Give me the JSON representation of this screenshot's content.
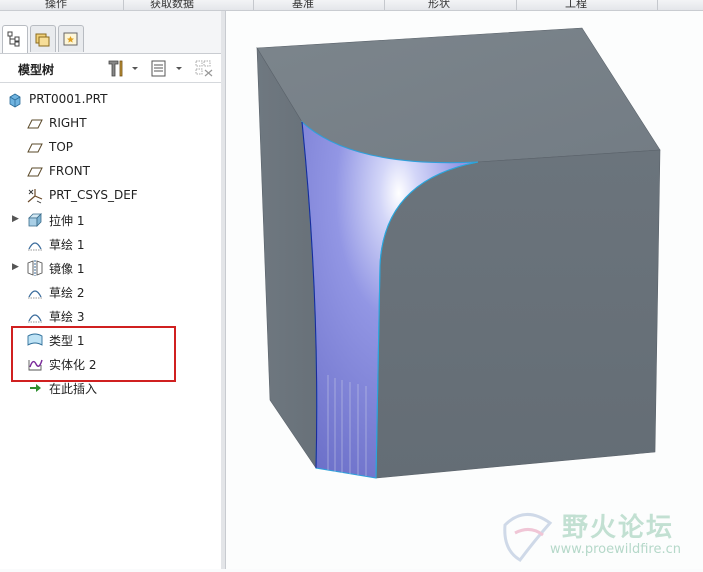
{
  "menu": {
    "items": [
      "操作",
      "获取数据",
      "基准",
      "形状",
      "工程"
    ]
  },
  "panel": {
    "tree_title": "模型树"
  },
  "tree": {
    "items": [
      {
        "label": "PRT0001.PRT",
        "icon": "part-icon",
        "expandable": false
      },
      {
        "label": "RIGHT",
        "icon": "datum-plane-icon",
        "expandable": false
      },
      {
        "label": "TOP",
        "icon": "datum-plane-icon",
        "expandable": false
      },
      {
        "label": "FRONT",
        "icon": "datum-plane-icon",
        "expandable": false
      },
      {
        "label": "PRT_CSYS_DEF",
        "icon": "csys-icon",
        "expandable": false
      },
      {
        "label": "拉伸 1",
        "icon": "extrude-icon",
        "expandable": true
      },
      {
        "label": "草绘 1",
        "icon": "sketch-icon",
        "expandable": false
      },
      {
        "label": "镜像 1",
        "icon": "mirror-icon",
        "expandable": true
      },
      {
        "label": "草绘 2",
        "icon": "sketch-icon",
        "expandable": false
      },
      {
        "label": "草绘 3",
        "icon": "sketch-icon",
        "expandable": false
      },
      {
        "label": "类型 1",
        "icon": "boundary-blend-icon",
        "expandable": false
      },
      {
        "label": "实体化 2",
        "icon": "solidify-icon",
        "expandable": false
      },
      {
        "label": "在此插入",
        "icon": "insert-here-arrow-icon",
        "expandable": false
      }
    ]
  },
  "watermark": {
    "title": "野火论坛",
    "url": "www.proewildfire.cn"
  },
  "colors": {
    "highlight": "#d02020",
    "model_body": "#6e777f",
    "surface": "#8e93e6"
  }
}
